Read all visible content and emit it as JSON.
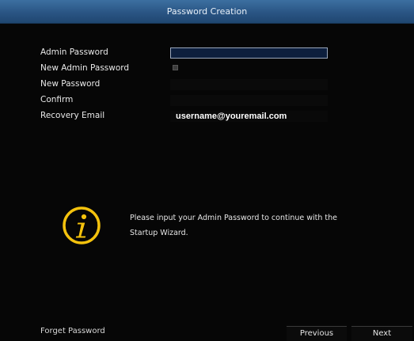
{
  "window": {
    "title": "Password Creation"
  },
  "form": {
    "admin_password_label": "Admin Password",
    "new_admin_password_label": "New Admin Password",
    "new_password_label": "New Password",
    "confirm_label": "Confirm",
    "recovery_email_label": "Recovery Email",
    "admin_password_value": "",
    "new_admin_password_checked": false,
    "recovery_email_value": "username@youremail.com"
  },
  "info": {
    "icon": "info-icon",
    "message": "Please input your Admin Password to continue with the Startup Wizard."
  },
  "footer": {
    "forget_password": "Forget Password",
    "previous": "Previous",
    "next": "Next"
  },
  "colors": {
    "titlebar": "#2a5584",
    "background": "#060606",
    "input_fill": "#0d1f3d",
    "icon_yellow": "#f4c20d"
  }
}
